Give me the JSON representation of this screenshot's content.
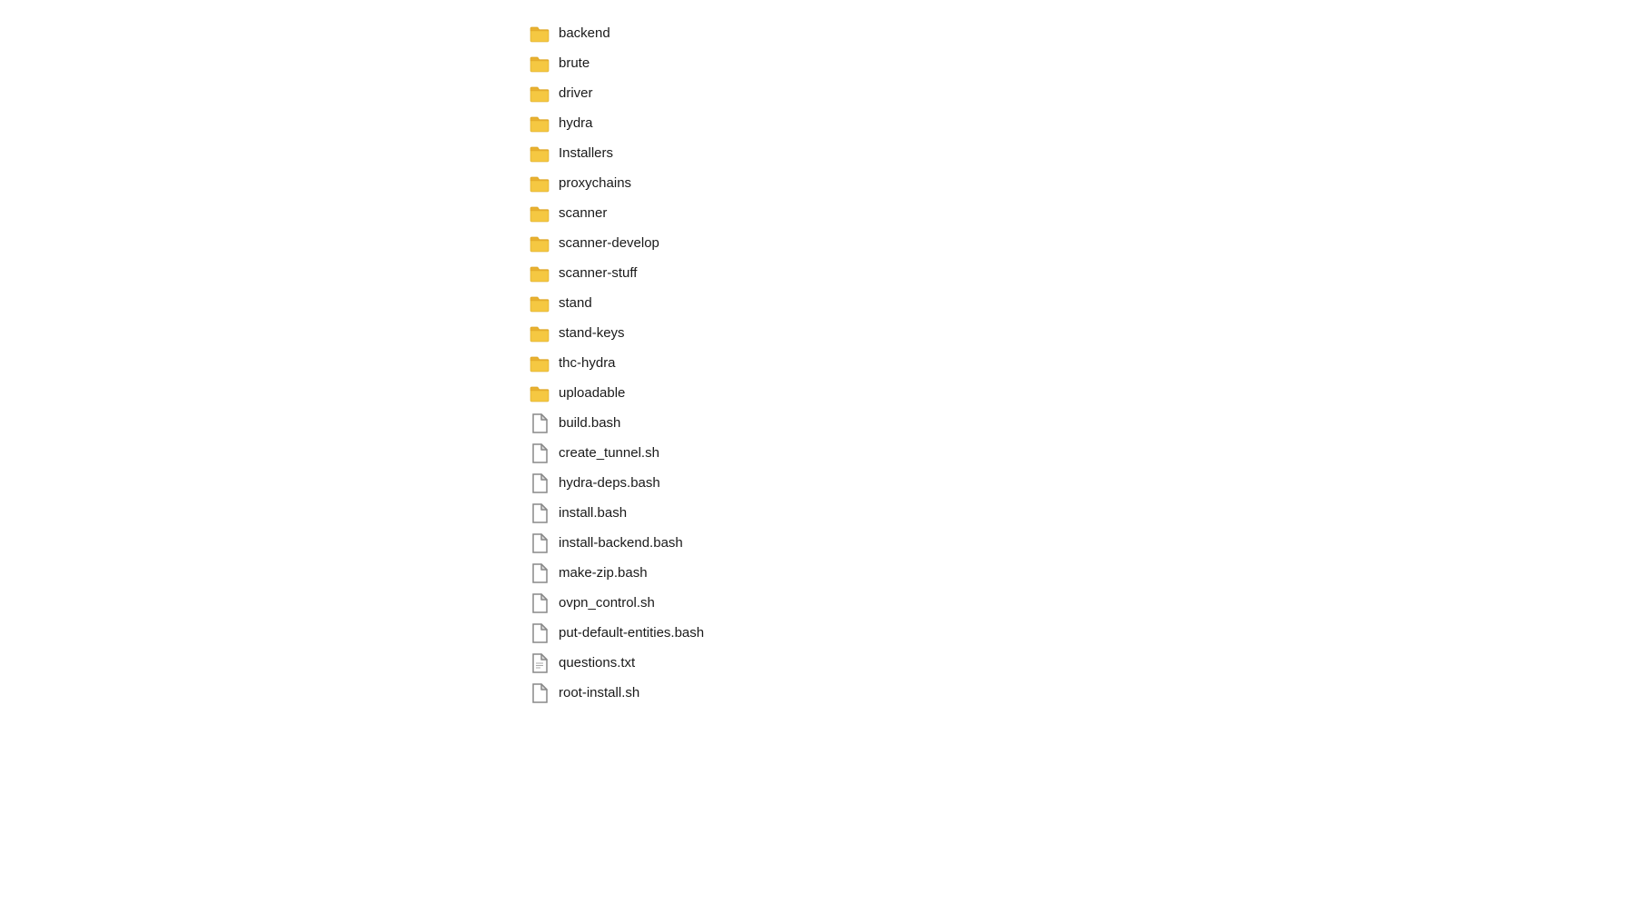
{
  "fileList": {
    "folders": [
      {
        "name": "backend",
        "type": "folder"
      },
      {
        "name": "brute",
        "type": "folder"
      },
      {
        "name": "driver",
        "type": "folder"
      },
      {
        "name": "hydra",
        "type": "folder"
      },
      {
        "name": "Installers",
        "type": "folder"
      },
      {
        "name": "proxychains",
        "type": "folder"
      },
      {
        "name": "scanner",
        "type": "folder"
      },
      {
        "name": "scanner-develop",
        "type": "folder"
      },
      {
        "name": "scanner-stuff",
        "type": "folder"
      },
      {
        "name": "stand",
        "type": "folder"
      },
      {
        "name": "stand-keys",
        "type": "folder"
      },
      {
        "name": "thc-hydra",
        "type": "folder"
      },
      {
        "name": "uploadable",
        "type": "folder"
      }
    ],
    "files": [
      {
        "name": "build.bash",
        "type": "file"
      },
      {
        "name": "create_tunnel.sh",
        "type": "file"
      },
      {
        "name": "hydra-deps.bash",
        "type": "file"
      },
      {
        "name": "install.bash",
        "type": "file"
      },
      {
        "name": "install-backend.bash",
        "type": "file"
      },
      {
        "name": "make-zip.bash",
        "type": "file"
      },
      {
        "name": "ovpn_control.sh",
        "type": "file"
      },
      {
        "name": "put-default-entities.bash",
        "type": "file"
      },
      {
        "name": "questions.txt",
        "type": "file-txt"
      },
      {
        "name": "root-install.sh",
        "type": "file"
      }
    ]
  }
}
